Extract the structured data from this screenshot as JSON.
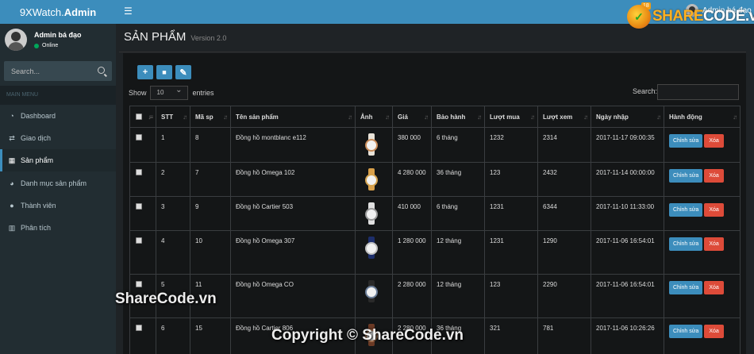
{
  "app": {
    "logo_light": "9XWatch.",
    "logo_bold": "Admin",
    "menu_toggle_icon": "☰",
    "notification_count": "18",
    "top_user_name": "Admin bá đạo"
  },
  "watermark": {
    "logo_prefix": "SHARE",
    "logo_suffix": "CODE.vn",
    "middle": "ShareCode.vn",
    "bottom": "Copyright © ShareCode.vn"
  },
  "sidebar": {
    "user_name": "Admin bá đạo",
    "status": "Online",
    "search_placeholder": "Search...",
    "menu_header": "MAIN MENU",
    "items": [
      {
        "label": "Dashboard",
        "icon": "dashboard-icon",
        "glyph": "◔"
      },
      {
        "label": "Giao dịch",
        "icon": "exchange-icon",
        "glyph": "⇄"
      },
      {
        "label": "Sản phẩm",
        "icon": "grid-icon",
        "glyph": "▦"
      },
      {
        "label": "Danh mục sản phẩm",
        "icon": "pie-chart-icon",
        "glyph": "◕"
      },
      {
        "label": "Thành viên",
        "icon": "user-icon",
        "glyph": "●"
      },
      {
        "label": "Phân tích",
        "icon": "bar-chart-icon",
        "glyph": "▥"
      }
    ],
    "active_index": 2
  },
  "page": {
    "title": "SẢN PHẨM",
    "version": "Version 2.0"
  },
  "toolbar": {
    "add_icon": "+",
    "delete_icon": "🗑",
    "edit_icon": "✎"
  },
  "table_controls": {
    "show_label": "Show",
    "entries_value": "10",
    "entries_label": "entries",
    "search_label": "Search:"
  },
  "colors": {
    "primary": "#3c8dbc",
    "danger": "#dd4b39",
    "sidebar_bg": "#222d32",
    "content_bg": "#1f2326"
  },
  "table": {
    "headers": [
      "STT",
      "Mã sp",
      "Tên sản phẩm",
      "Ảnh",
      "Giá",
      "Bảo hành",
      "Lượt mua",
      "Lượt xem",
      "Ngày nhập",
      "Hành động"
    ],
    "edit_label": "Chỉnh sửa",
    "delete_label": "Xóa",
    "rows": [
      {
        "stt": "1",
        "code": "8",
        "name": "Đồng hồ montblanc e112",
        "price": "380 000",
        "warranty": "6 tháng",
        "bought": "1232",
        "views": "2314",
        "date": "2017-11-17 09:00:35",
        "strap": "#e8e2d8",
        "bezel": "#c98c5a"
      },
      {
        "stt": "2",
        "code": "7",
        "name": "Đồng hồ Omega 102",
        "price": "4 280 000",
        "warranty": "36 tháng",
        "bought": "123",
        "views": "2432",
        "date": "2017-11-14 00:00:00",
        "strap": "#d9a04a",
        "bezel": "#d4a24e"
      },
      {
        "stt": "3",
        "code": "9",
        "name": "Đồng hồ Cartier 503",
        "price": "410 000",
        "warranty": "6 tháng",
        "bought": "1231",
        "views": "6344",
        "date": "2017-11-10 11:33:00",
        "strap": "#e0e0e0",
        "bezel": "#9a9a9a"
      },
      {
        "stt": "4",
        "code": "10",
        "name": "Đồng hồ Omega 307",
        "price": "1 280 000",
        "warranty": "12 tháng",
        "bought": "1231",
        "views": "1290",
        "date": "2017-11-06 16:54:01",
        "strap": "#1d2e6b",
        "bezel": "#c0c0c0"
      },
      {
        "stt": "5",
        "code": "11",
        "name": "Đồng hồ Omega CO",
        "price": "2 280 000",
        "warranty": "12 tháng",
        "bought": "123",
        "views": "2290",
        "date": "2017-11-06 16:54:01",
        "strap": "#2a2a2a",
        "bezel": "#6b7e99"
      },
      {
        "stt": "6",
        "code": "15",
        "name": "Đồng hồ Cartier 806",
        "price": "2 280 000",
        "warranty": "36 tháng",
        "bought": "321",
        "views": "781",
        "date": "2017-11-06 10:26:26",
        "strap": "#6b3a25",
        "bezel": "#b07a56"
      }
    ]
  }
}
